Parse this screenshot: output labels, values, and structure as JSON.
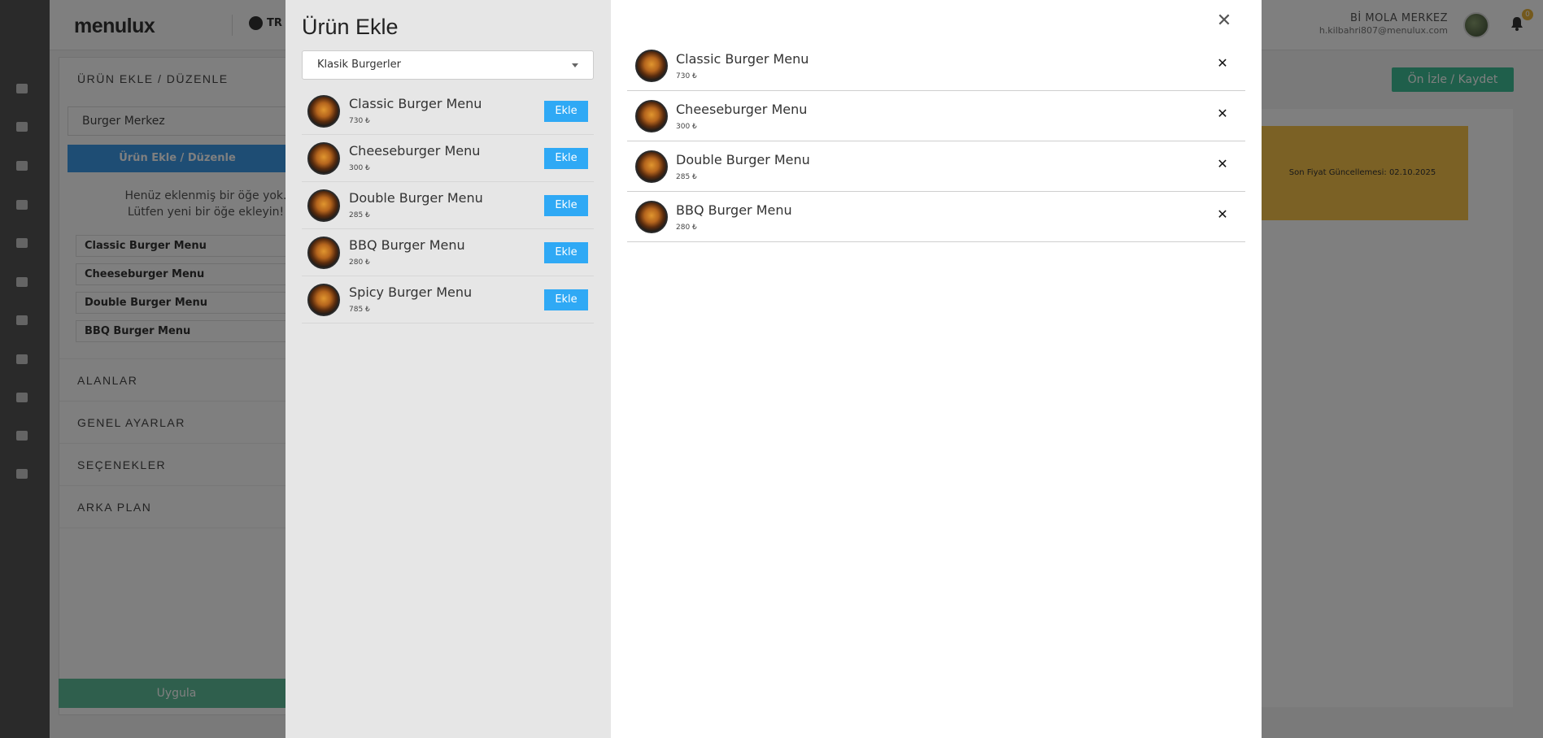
{
  "app": {
    "logo": "menulux",
    "language": "TR",
    "user_name": "Bİ MOLA MERKEZ",
    "user_email": "h.kilbahri807@menulux.com",
    "notification_count": "0"
  },
  "panel": {
    "section_add_edit": "ÜRÜN EKLE / DÜZENLE",
    "venue_value": "Burger Merkez",
    "edit_button": "Ürün Ekle / Düzenle",
    "empty_line1": "Henüz eklenmiş bir öğe yok.",
    "empty_line2": "Lütfen yeni bir öğe ekleyin!",
    "items": [
      "Classic Burger Menu",
      "Cheeseburger Menu",
      "Double Burger Menu",
      "BBQ Burger Menu"
    ],
    "section_fields": "ALANLAR",
    "section_general": "GENEL AYARLAR",
    "section_options": "SEÇENEKLER",
    "section_background": "ARKA PLAN",
    "apply_button": "Uygula"
  },
  "preview": {
    "button": "Ön İzle / Kaydet",
    "banner_text": "Son Fiyat Güncellemesi: 02.10.2025"
  },
  "modal": {
    "title": "Ürün Ekle",
    "category_selected": "Klasik Burgerler",
    "add_label": "Ekle",
    "close_glyph": "✕",
    "remove_glyph": "✕",
    "products": [
      {
        "name": "Classic Burger Menu",
        "price": "730 ₺"
      },
      {
        "name": "Cheeseburger Menu",
        "price": "300 ₺"
      },
      {
        "name": "Double Burger Menu",
        "price": "285 ₺"
      },
      {
        "name": "BBQ Burger Menu",
        "price": "280 ₺"
      },
      {
        "name": "Spicy Burger Menu",
        "price": "785 ₺"
      }
    ],
    "selected": [
      {
        "name": "Classic Burger Menu",
        "price": "730 ₺"
      },
      {
        "name": "Cheeseburger Menu",
        "price": "300 ₺"
      },
      {
        "name": "Double Burger Menu",
        "price": "285 ₺"
      },
      {
        "name": "BBQ Burger Menu",
        "price": "280 ₺"
      }
    ]
  }
}
